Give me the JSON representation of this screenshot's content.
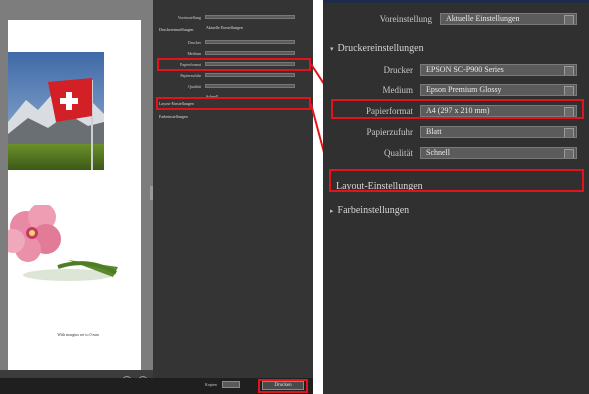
{
  "left_panel": {
    "caption": "With margins set to 0 mm",
    "small_panel": {
      "preset": {
        "label": "Voreinstellung",
        "value": "Aktuelle Einstellungen"
      },
      "printer_section": "Druckereinstellungen",
      "printer": {
        "label": "Drucker",
        "value": "EPSON SC-P900 Series"
      },
      "media": {
        "label": "Medium",
        "value": "Epson Premium Glossy"
      },
      "paper_format": {
        "label": "Papierformat",
        "value": "A4 (297 x 210 mm)"
      },
      "paper_source": {
        "label": "Papierzufuhr",
        "value": "Blatt"
      },
      "quality": {
        "label": "Qualität",
        "value": "Schnell"
      },
      "layout_section": "Layout-Einstellungen",
      "color_section": "Farbeinstellungen"
    },
    "print_button": "Drucken",
    "copies_label": "Kopien"
  },
  "right_panel": {
    "preset": {
      "label": "Voreinstellung",
      "value": "Aktuelle Einstellungen"
    },
    "printer_section": "Druckereinstellungen",
    "printer": {
      "label": "Drucker",
      "value": "EPSON SC-P900 Series"
    },
    "media": {
      "label": "Medium",
      "value": "Epson Premium Glossy"
    },
    "paper_format": {
      "label": "Papierformat",
      "value": "A4 (297 x 210 mm)"
    },
    "paper_source": {
      "label": "Papierzufuhr",
      "value": "Blatt"
    },
    "quality": {
      "label": "Qualität",
      "value": "Schnell"
    },
    "layout_section": "Layout-Einstellungen",
    "color_section": "Farbeinstellungen"
  },
  "colors": {
    "highlight": "#e2141b",
    "panel_bg": "#303030",
    "field_bg": "#5b5b5b"
  }
}
